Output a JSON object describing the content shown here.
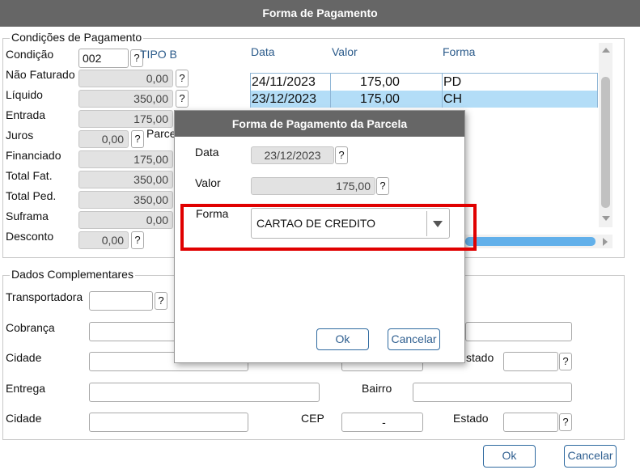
{
  "window_title": "Forma de Pagamento",
  "conditions": {
    "legend": "Condições de Pagamento",
    "condicao": {
      "label": "Condição",
      "value": "002",
      "tipo": "TIPO B"
    },
    "fields": [
      {
        "label": "Não Faturado",
        "value": "0,00"
      },
      {
        "label": "Líquido",
        "value": "350,00"
      },
      {
        "label": "Entrada",
        "value": "175,00"
      },
      {
        "label": "Juros",
        "value": "0,00",
        "extra": "Parce"
      },
      {
        "label": "Financiado",
        "value": "175,00"
      },
      {
        "label": "Total Fat.",
        "value": "350,00"
      },
      {
        "label": "Total Ped.",
        "value": "350,00"
      },
      {
        "label": "Suframa",
        "value": "0,00"
      },
      {
        "label": "Desconto",
        "value": "0,00"
      }
    ],
    "help": "?"
  },
  "grid": {
    "headers": [
      "Data",
      "Valor",
      "Forma"
    ],
    "rows": [
      {
        "data": "24/11/2023",
        "valor": "175,00",
        "forma": "PD"
      },
      {
        "data": "23/12/2023",
        "valor": "175,00",
        "forma": "CH"
      }
    ],
    "selected_row_color": "#b3ddf7"
  },
  "complementary": {
    "legend": "Dados Complementares",
    "transportadora": "Transportadora",
    "cobranca": "Cobrança",
    "cidade1": "Cidade",
    "estado1": "stado",
    "entrega": "Entrega",
    "bairro": "Bairro",
    "cidade2": "Cidade",
    "cep": "CEP",
    "cep_value": "-",
    "estado2": "Estado"
  },
  "dialog": {
    "title": "Forma de Pagamento da Parcela",
    "data_label": "Data",
    "data_value": "23/12/2023",
    "valor_label": "Valor",
    "valor_value": "175,00",
    "forma_label": "Forma",
    "forma_value": "CARTAO DE CREDITO",
    "ok": "Ok",
    "cancel": "Cancelar",
    "highlight_color": "#e00000"
  },
  "footer": {
    "ok": "Ok",
    "cancel": "Cancelar"
  },
  "colors": {
    "title_bg": "#666666",
    "accent": "#2f6aa0"
  }
}
